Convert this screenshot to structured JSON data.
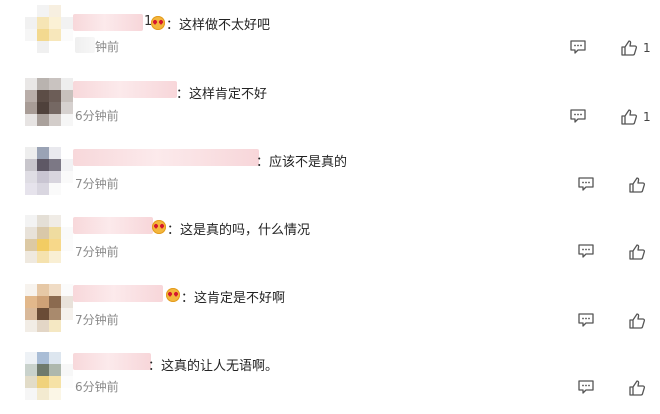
{
  "comments": [
    {
      "name_suffix": "1",
      "text": "：这样做不太好吧",
      "time": "钟前",
      "like_count": "1"
    },
    {
      "text": "：这样肯定不好",
      "time": "6分钟前",
      "like_count": "1"
    },
    {
      "text": "：应该不是真的",
      "time": "7分钟前",
      "like_count": ""
    },
    {
      "text": "：这是真的吗，什么情况",
      "time": "7分钟前",
      "like_count": ""
    },
    {
      "text": "：这肯定是不好啊",
      "time": "7分钟前",
      "like_count": ""
    },
    {
      "text": "：这真的让人无语啊。",
      "time": "6分钟前",
      "like_count": ""
    }
  ],
  "icons": {
    "reply": "comment-icon",
    "like": "thumbs-up-icon",
    "emoji": "emoji-icon"
  }
}
